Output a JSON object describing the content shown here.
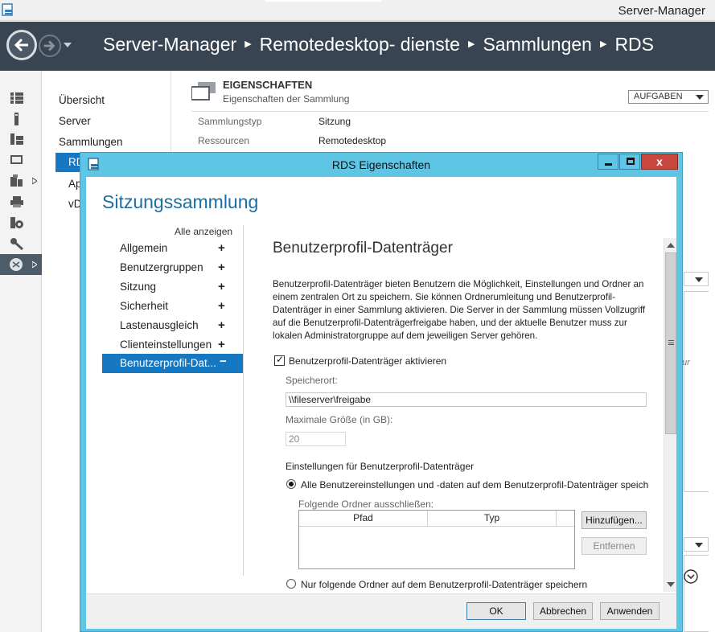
{
  "window": {
    "title": "Server-Manager"
  },
  "breadcrumb": [
    "Server-Manager",
    "Remotedesktop- dienste",
    "Sammlungen",
    "RDS"
  ],
  "nav": {
    "items": [
      "Übersicht",
      "Server",
      "Sammlungen",
      "RDS",
      "Ap",
      "vD"
    ]
  },
  "properties": {
    "heading": "EIGENSCHAFTEN",
    "subheading": "Eigenschaften der Sammlung",
    "tasks_label": "AUFGABEN",
    "rows": [
      {
        "key": "Sammlungstyp",
        "value": "Sitzung"
      },
      {
        "key": "Ressourcen",
        "value": "Remotedesktop"
      }
    ],
    "partial_text": "ur"
  },
  "dialog": {
    "title": "RDS Eigenschaften",
    "heading": "Sitzungssammlung",
    "show_all": "Alle anzeigen",
    "sections": [
      "Allgemein",
      "Benutzergruppen",
      "Sitzung",
      "Sicherheit",
      "Lastenausgleich",
      "Clienteinstellungen"
    ],
    "section_expand": "+",
    "selected_section": "Benutzerprofil-Dat...",
    "selected_collapse": "−",
    "content": {
      "title": "Benutzerprofil-Datenträger",
      "description": "Benutzerprofil-Datenträger bieten Benutzern die Möglichkeit, Einstellungen und Ordner an einem zentralen Ort zu speichern. Sie können Ordnerumleitung und Benutzerprofil-Datenträger in einer Sammlung aktivieren. Die Server in der Sammlung müssen Vollzugriff auf die Benutzerprofil-Datenträgerfreigabe haben, und der aktuelle Benutzer muss zur lokalen Administratorgruppe auf dem jeweiligen Server gehören.",
      "enable_label": "Benutzerprofil-Datenträger aktivieren",
      "enable_checked": true,
      "location_label": "Speicherort:",
      "location_value": "\\\\fileserver\\freigabe",
      "maxsize_label": "Maximale Größe (in GB):",
      "maxsize_value": "20",
      "settings_label": "Einstellungen für Benutzerprofil-Datenträger",
      "option_all": "Alle Benutzereinstellungen und -daten auf dem Benutzerprofil-Datenträger speich",
      "exclude_label": "Folgende Ordner ausschließen:",
      "grid_columns": [
        "Pfad",
        "Typ"
      ],
      "add_button": "Hinzufügen...",
      "remove_button": "Entfernen",
      "option_only": "Nur folgende Ordner auf dem Benutzerprofil-Datenträger speichern"
    },
    "buttons": {
      "ok": "OK",
      "cancel": "Abbrechen",
      "apply": "Anwenden"
    },
    "close_glyph": "x"
  }
}
